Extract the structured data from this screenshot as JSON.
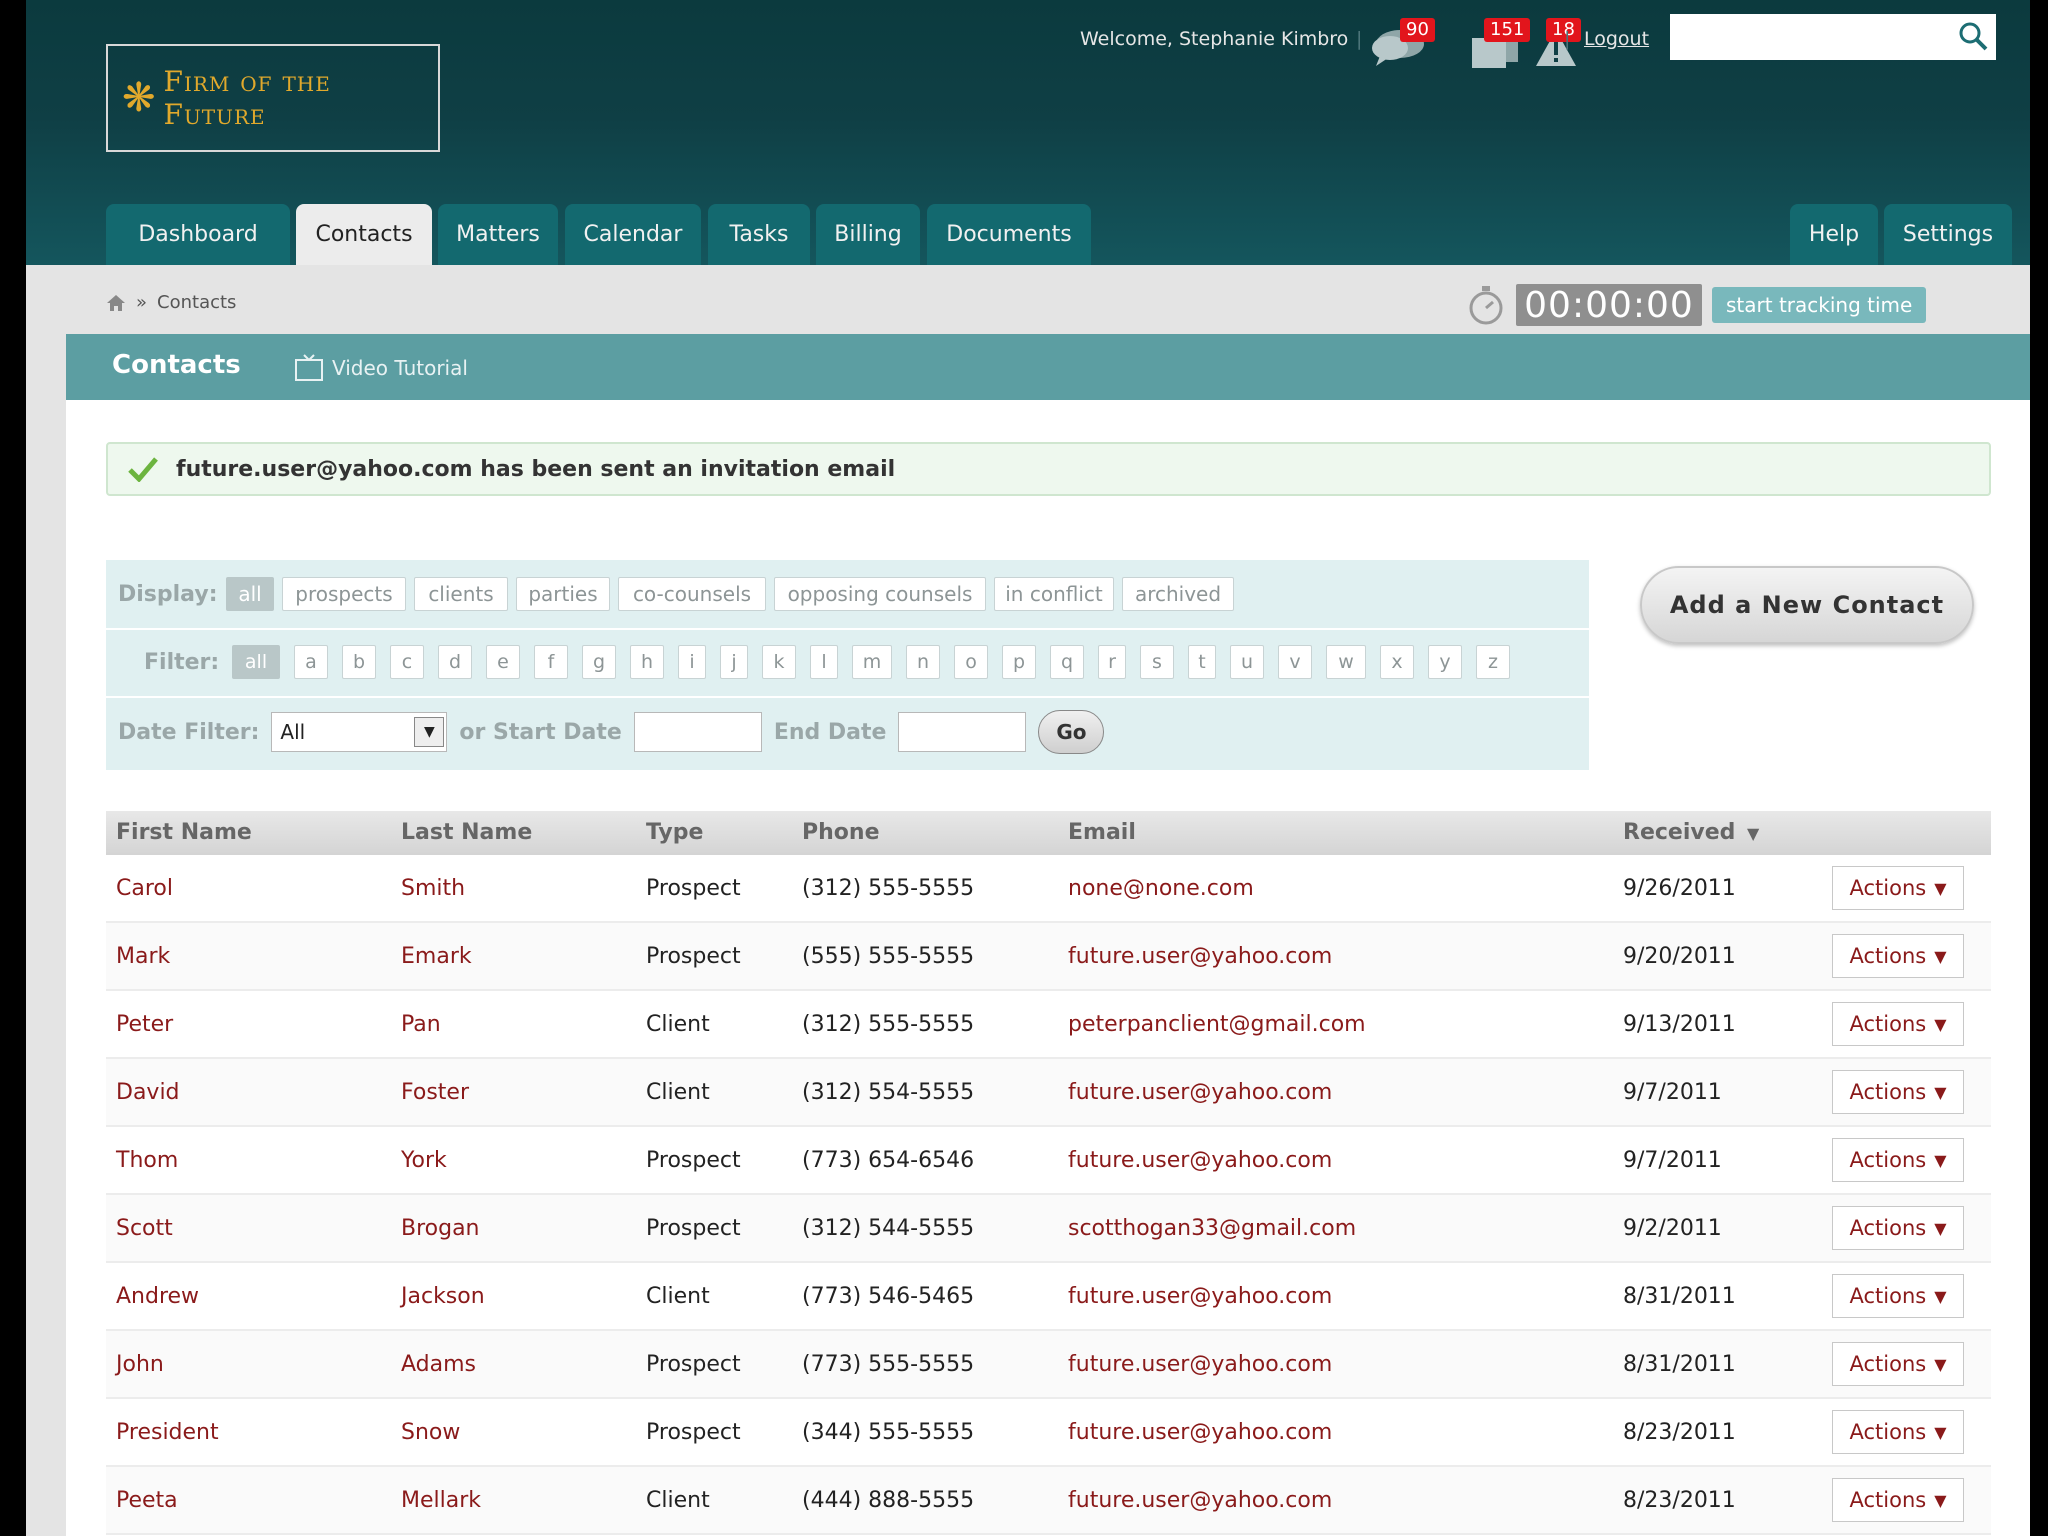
{
  "header": {
    "logo_text": "Firm of the Future",
    "welcome": "Welcome, Stephanie Kimbro",
    "notifications": [
      {
        "name": "messages",
        "count": "90"
      },
      {
        "name": "documents",
        "count": "151"
      },
      {
        "name": "alerts",
        "count": "18"
      }
    ],
    "logout": "Logout",
    "search_placeholder": ""
  },
  "nav": {
    "tabs": [
      "Dashboard",
      "Contacts",
      "Matters",
      "Calendar",
      "Tasks",
      "Billing",
      "Documents"
    ],
    "active": "Contacts",
    "right_tabs": [
      "Help",
      "Settings"
    ]
  },
  "breadcrumb": {
    "sep": "»",
    "current": "Contacts"
  },
  "timer": {
    "display": "00:00:00",
    "button": "start tracking time"
  },
  "page": {
    "title": "Contacts",
    "video_tutorial": "Video Tutorial"
  },
  "alert": {
    "message": "future.user@yahoo.com has been sent an invitation email"
  },
  "filters": {
    "display_label": "Display:",
    "display_options": [
      "all",
      "prospects",
      "clients",
      "parties",
      "co-counsels",
      "opposing counsels",
      "in conflict",
      "archived"
    ],
    "filter_label": "Filter:",
    "letters": [
      "all",
      "a",
      "b",
      "c",
      "d",
      "e",
      "f",
      "g",
      "h",
      "i",
      "j",
      "k",
      "l",
      "m",
      "n",
      "o",
      "p",
      "q",
      "r",
      "s",
      "t",
      "u",
      "v",
      "w",
      "x",
      "y",
      "z"
    ],
    "date_filter_label": "Date Filter:",
    "date_filter_value": "All",
    "or_start_date": "or Start Date",
    "end_date": "End Date",
    "go": "Go"
  },
  "add_contact": "Add a New Contact",
  "table": {
    "headers": [
      "First Name",
      "Last Name",
      "Type",
      "Phone",
      "Email",
      "Received"
    ],
    "sorted_by": "Received",
    "action_label": "Actions",
    "rows": [
      {
        "first": "Carol",
        "last": "Smith",
        "type": "Prospect",
        "phone": "(312) 555-5555",
        "email": "none@none.com",
        "received": "9/26/2011"
      },
      {
        "first": "Mark",
        "last": "Emark",
        "type": "Prospect",
        "phone": "(555) 555-5555",
        "email": "future.user@yahoo.com",
        "received": "9/20/2011"
      },
      {
        "first": "Peter",
        "last": "Pan",
        "type": "Client",
        "phone": "(312) 555-5555",
        "email": "peterpanclient@gmail.com",
        "received": "9/13/2011"
      },
      {
        "first": "David",
        "last": "Foster",
        "type": "Client",
        "phone": "(312) 554-5555",
        "email": "future.user@yahoo.com",
        "received": "9/7/2011"
      },
      {
        "first": "Thom",
        "last": "York",
        "type": "Prospect",
        "phone": "(773) 654-6546",
        "email": "future.user@yahoo.com",
        "received": "9/7/2011"
      },
      {
        "first": "Scott",
        "last": "Brogan",
        "type": "Prospect",
        "phone": "(312) 544-5555",
        "email": "scotthogan33@gmail.com",
        "received": "9/2/2011"
      },
      {
        "first": "Andrew",
        "last": "Jackson",
        "type": "Client",
        "phone": "(773) 546-5465",
        "email": "future.user@yahoo.com",
        "received": "8/31/2011"
      },
      {
        "first": "John",
        "last": "Adams",
        "type": "Prospect",
        "phone": "(773) 555-5555",
        "email": "future.user@yahoo.com",
        "received": "8/31/2011"
      },
      {
        "first": "President",
        "last": "Snow",
        "type": "Prospect",
        "phone": "(344) 555-5555",
        "email": "future.user@yahoo.com",
        "received": "8/23/2011"
      },
      {
        "first": "Peeta",
        "last": "Mellark",
        "type": "Client",
        "phone": "(444) 888-5555",
        "email": "future.user@yahoo.com",
        "received": "8/23/2011"
      }
    ]
  },
  "colors": {
    "header_bg": "#0f3f45",
    "tab_bg": "#13696f",
    "title_bar": "#5c9ea2",
    "link": "#8a1a1a",
    "logo_gold": "#e1a92c",
    "badge_red": "#e2151c"
  },
  "icons": [
    "snowflake-logo-icon",
    "speech-bubble-icon",
    "documents-icon",
    "alert-triangle-icon",
    "search-icon",
    "home-icon",
    "stopwatch-icon",
    "tv-icon",
    "checkmark-icon",
    "dropdown-arrow-icon",
    "sort-down-icon"
  ]
}
